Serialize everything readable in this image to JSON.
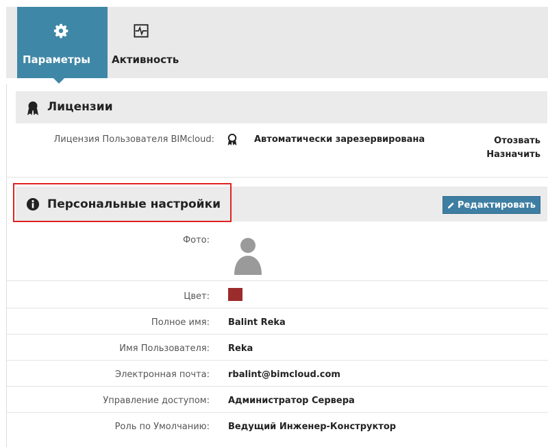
{
  "tabs": [
    {
      "label": "Параметры",
      "icon": "gear-icon",
      "active": true
    },
    {
      "label": "Активность",
      "icon": "activity-monitor-icon",
      "active": false
    }
  ],
  "licenses": {
    "title": "Лицензии",
    "icon": "award-ribbon-icon",
    "row_label": "Лицензия Пользователя BIMcloud:",
    "row_value": "Автоматически зарезервирована",
    "revoke_label": "Отозвать",
    "assign_label": "Назначить"
  },
  "personal": {
    "title": "Персональные настройки",
    "icon": "info-icon",
    "edit_label": "Редактировать",
    "photo_label": "Фото:",
    "color_label": "Цвет:",
    "color_value": "#9b2c2c",
    "fields": [
      {
        "label": "Полное имя:",
        "value": "Balint Reka"
      },
      {
        "label": "Имя Пользователя:",
        "value": "Reka"
      },
      {
        "label": "Электронная почта:",
        "value": "rbalint@bimcloud.com"
      },
      {
        "label": "Управление доступом:",
        "value": "Администратор Сервера"
      },
      {
        "label": "Роль по Умолчанию:",
        "value": "Ведущий Инженер-Конструктор"
      }
    ]
  },
  "colors": {
    "accent": "#3f87a6",
    "highlight": "#e02020",
    "header_bg": "#ebebeb"
  }
}
